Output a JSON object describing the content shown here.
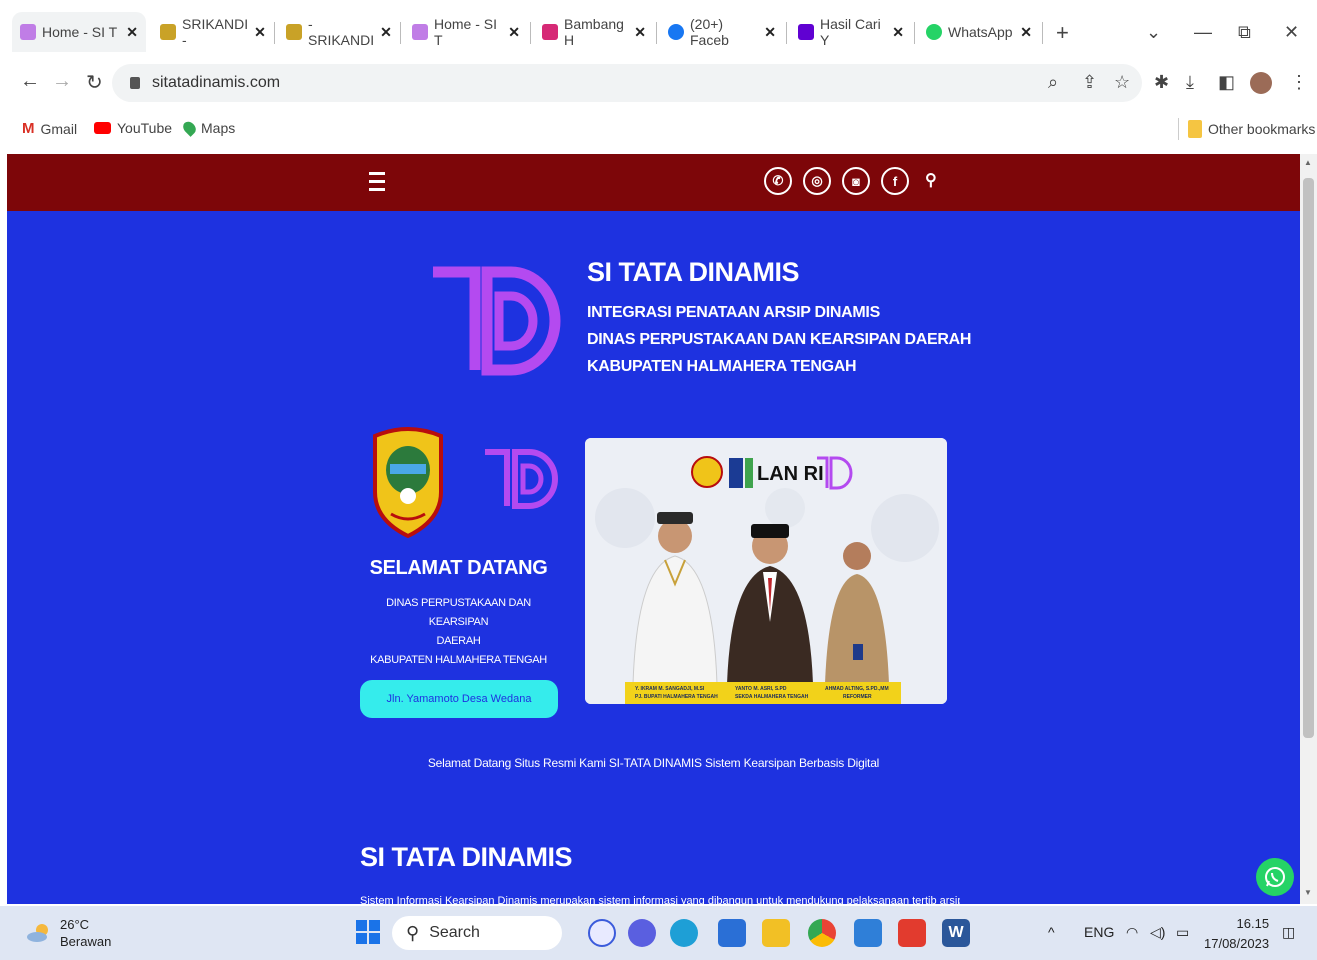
{
  "browser": {
    "tabs": [
      {
        "label": "Home - SI T",
        "fav": "#c07de6",
        "active": true
      },
      {
        "label": "SRIKANDI -",
        "fav": "#c9a227"
      },
      {
        "label": "- SRIKANDI",
        "fav": "#c9a227"
      },
      {
        "label": "Home - SI T",
        "fav": "#c07de6"
      },
      {
        "label": "Bambang H",
        "fav": "#d62976"
      },
      {
        "label": "(20+) Faceb",
        "fav": "#1877f2"
      },
      {
        "label": "Hasil Cari Y",
        "fav": "#6001d2"
      },
      {
        "label": "WhatsApp",
        "fav": "#25d366"
      }
    ],
    "new_tab": "+",
    "url": "sitatadinamis.com",
    "bookmarks": [
      "Gmail",
      "YouTube",
      "Maps"
    ],
    "other_bookmarks": "Other bookmarks"
  },
  "site": {
    "social_icons": [
      "phone-icon",
      "whatsapp-icon",
      "instagram-icon",
      "facebook-icon"
    ],
    "hero": {
      "title": "SI TATA DINAMIS",
      "line1": "INTEGRASI PENATAAN ARSIP DINAMIS",
      "line2": "DINAS PERPUSTAKAAN DAN KEARSIPAN DAERAH",
      "line3": "KABUPATEN HALMAHERA TENGAH"
    },
    "welcome": {
      "title": "SELAMAT DATANG",
      "sub1": "DINAS PERPUSTAKAAN DAN KEARSIPAN",
      "sub2": "DAERAH",
      "sub3": "KABUPATEN HALMAHERA TENGAH",
      "address": "Jln. Yamamoto Desa Wedana"
    },
    "banner": {
      "lan_label": "LAN RI",
      "caption1": "Y. IKRAM M. SANGADJI, M.SI",
      "caption1b": "PJ. BUPATI HALMAHERA TENGAH",
      "caption2": "YANTO M. ASRI, S.PD",
      "caption2b": "SEKDA HALMAHERA TENGAH",
      "caption3": "AHMAD ALTING, S.PD.,MM",
      "caption3b": "REFORMER"
    },
    "welcome_line": "Selamat Datang Situs Resmi Kami SI-TATA DINAMIS Sistem Kearsipan Berbasis Digital",
    "section_title": "SI TATA DINAMIS",
    "section_text": "Sistem Informasi Kearsipan Dinamis merupakan sistem informasi yang dibangun untuk mendukung pelaksanaan tertib arsip di"
  },
  "taskbar": {
    "temp": "26°C",
    "weather": "Berawan",
    "search_label": "Search",
    "lang": "ENG",
    "time": "16.15",
    "date": "17/08/2023"
  },
  "colors": {
    "navbar": "#7d0609",
    "page_bg": "#1e32e0",
    "accent_purple": "#b44af0",
    "address_button": "#35ecec"
  }
}
